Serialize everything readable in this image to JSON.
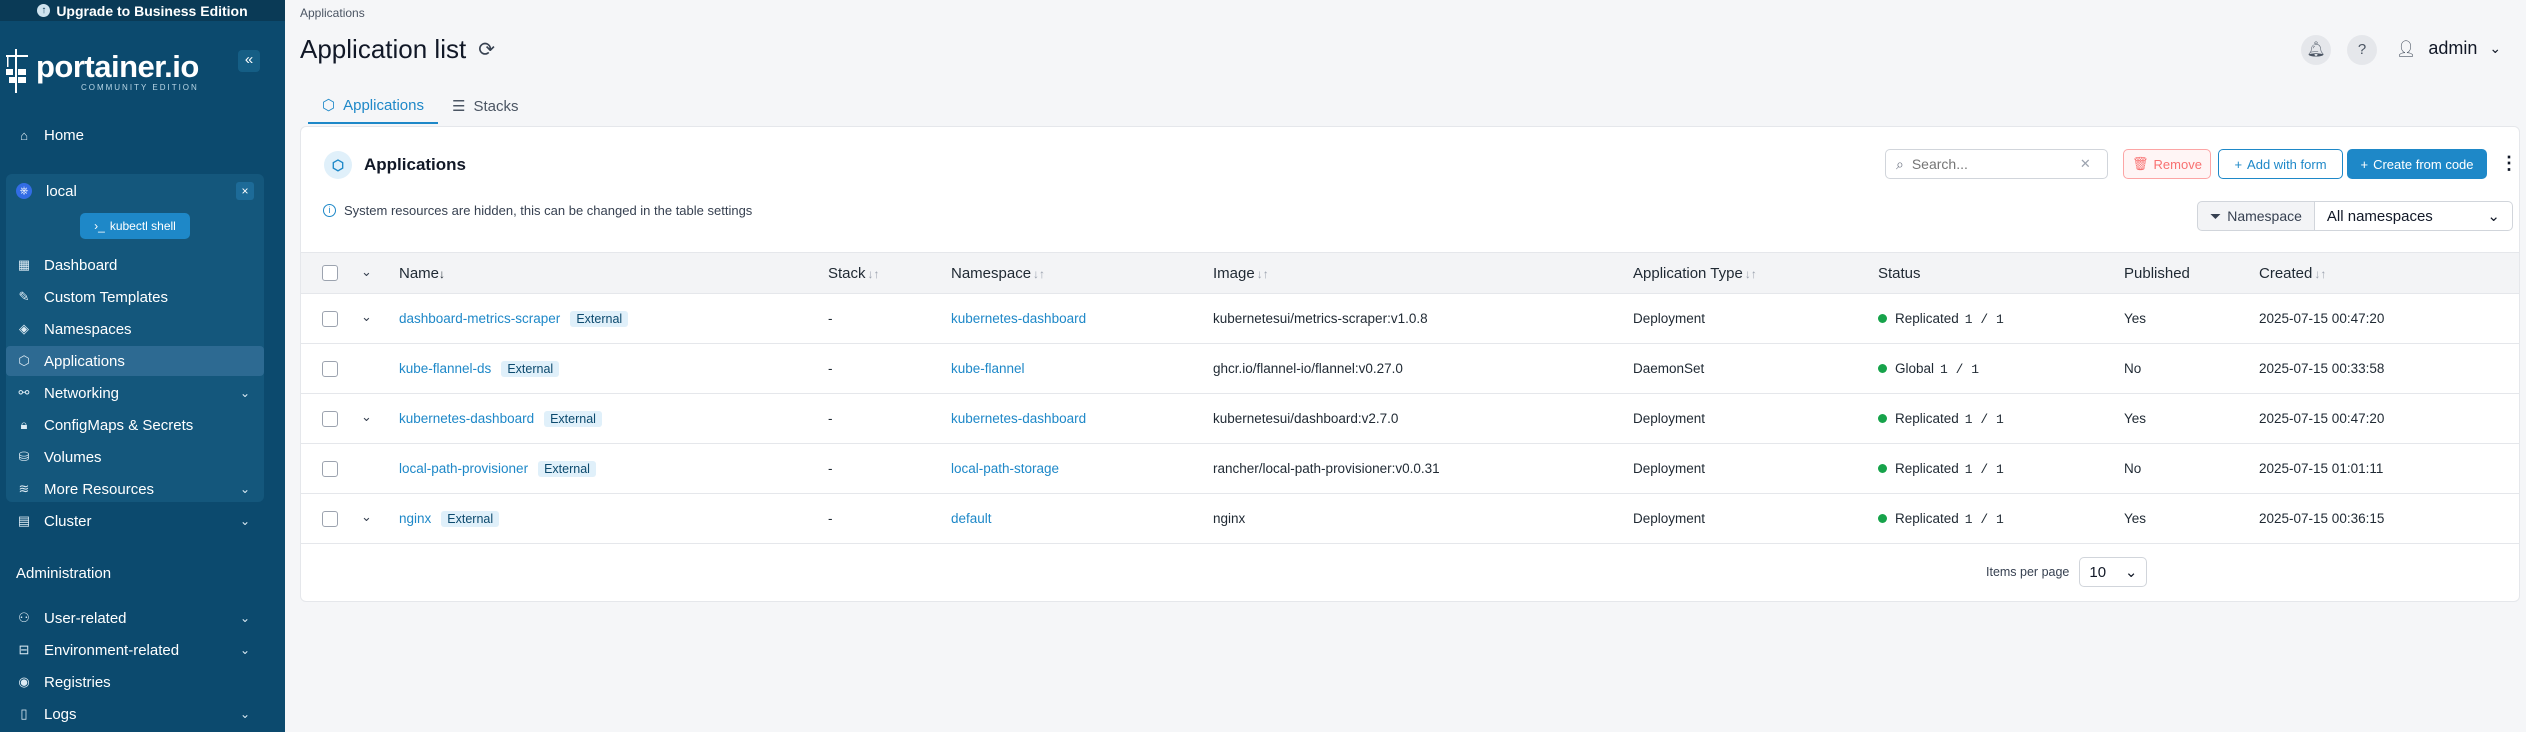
{
  "sidebar": {
    "upgrade_label": "Upgrade to Business Edition",
    "logo_main": "portainer.io",
    "logo_sub": "COMMUNITY EDITION",
    "home": "Home",
    "environment": {
      "name": "local",
      "kubectl_label": "kubectl shell",
      "items": [
        "Dashboard",
        "Custom Templates",
        "Namespaces",
        "Applications",
        "Networking",
        "ConfigMaps & Secrets",
        "Volumes",
        "More Resources",
        "Cluster"
      ]
    },
    "administration_title": "Administration",
    "admin_items": [
      "User-related",
      "Environment-related",
      "Registries",
      "Logs"
    ]
  },
  "header": {
    "breadcrumb": "Applications",
    "title": "Application list",
    "user": "admin"
  },
  "tabs": [
    "Applications",
    "Stacks"
  ],
  "card": {
    "title": "Applications",
    "search_placeholder": "Search...",
    "remove_label": "Remove",
    "add_form_label": "Add with form",
    "create_code_label": "Create from code",
    "info_text": "System resources are hidden, this can be changed in the table settings",
    "namespace_label": "Namespace",
    "namespace_value": "All namespaces"
  },
  "table": {
    "columns": [
      "Name",
      "Stack",
      "Namespace",
      "Image",
      "Application Type",
      "Status",
      "Published",
      "Created"
    ],
    "rows": [
      {
        "name": "dashboard-metrics-scraper",
        "badge": "External",
        "stack": "-",
        "namespace": "kubernetes-dashboard",
        "image": "kubernetesui/metrics-scraper:v1.0.8",
        "type": "Deployment",
        "status": "Replicated",
        "count": "1 / 1",
        "published": "Yes",
        "created": "2025-07-15 00:47:20"
      },
      {
        "name": "kube-flannel-ds",
        "badge": "External",
        "stack": "-",
        "namespace": "kube-flannel",
        "image": "ghcr.io/flannel-io/flannel:v0.27.0",
        "type": "DaemonSet",
        "status": "Global",
        "count": "1 / 1",
        "published": "No",
        "created": "2025-07-15 00:33:58"
      },
      {
        "name": "kubernetes-dashboard",
        "badge": "External",
        "stack": "-",
        "namespace": "kubernetes-dashboard",
        "image": "kubernetesui/dashboard:v2.7.0",
        "type": "Deployment",
        "status": "Replicated",
        "count": "1 / 1",
        "published": "Yes",
        "created": "2025-07-15 00:47:20"
      },
      {
        "name": "local-path-provisioner",
        "badge": "External",
        "stack": "-",
        "namespace": "local-path-storage",
        "image": "rancher/local-path-provisioner:v0.0.31",
        "type": "Deployment",
        "status": "Replicated",
        "count": "1 / 1",
        "published": "No",
        "created": "2025-07-15 01:01:11"
      },
      {
        "name": "nginx",
        "badge": "External",
        "stack": "-",
        "namespace": "default",
        "image": "nginx",
        "type": "Deployment",
        "status": "Replicated",
        "count": "1 / 1",
        "published": "Yes",
        "created": "2025-07-15 00:36:15"
      }
    ],
    "items_per_page_label": "Items per page",
    "items_per_page": "10"
  },
  "colors": {
    "sidebar": "#0c4a6e",
    "accent": "#1e88c8",
    "status_ok": "#16a34a"
  }
}
